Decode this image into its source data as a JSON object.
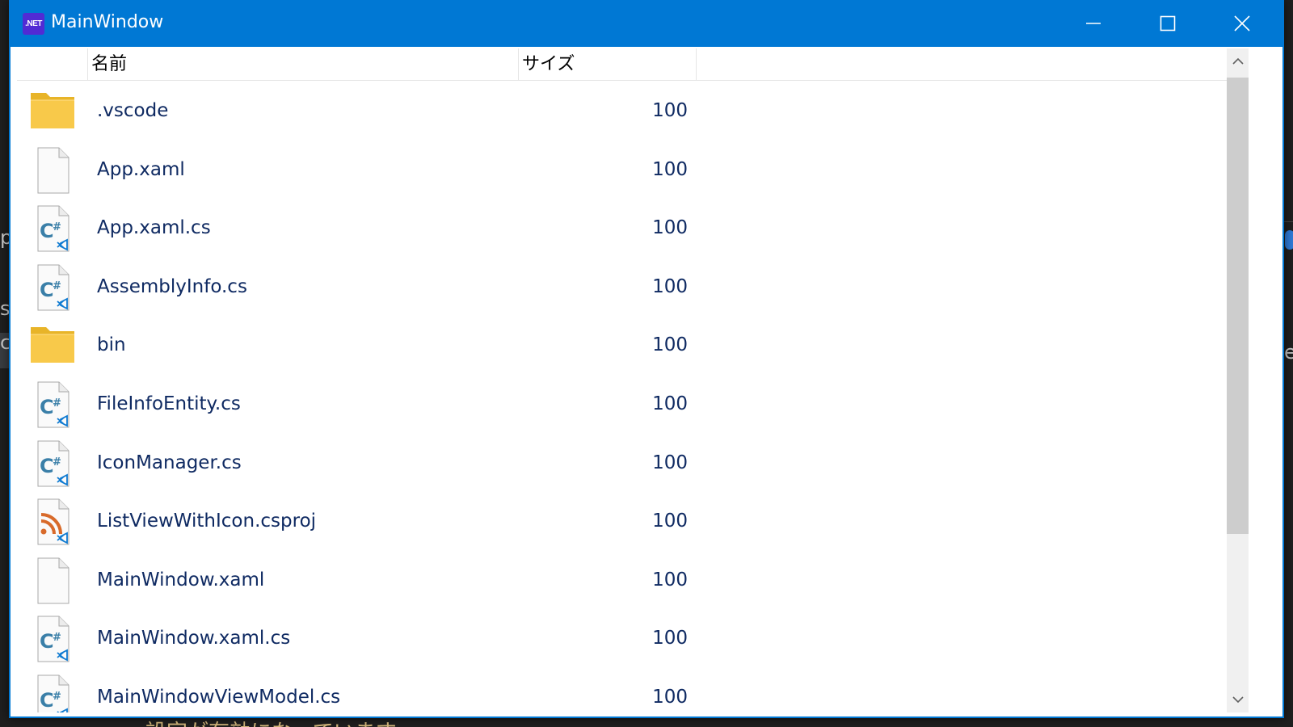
{
  "window": {
    "title": "MainWindow",
    "app_icon_text": ".NET"
  },
  "columns": {
    "name": "名前",
    "size": "サイズ"
  },
  "files": [
    {
      "name": ".vscode",
      "size": "100",
      "icon": "folder-icon"
    },
    {
      "name": "App.xaml",
      "size": "100",
      "icon": "file-icon"
    },
    {
      "name": "App.xaml.cs",
      "size": "100",
      "icon": "csharp-file-icon"
    },
    {
      "name": "AssemblyInfo.cs",
      "size": "100",
      "icon": "csharp-file-icon"
    },
    {
      "name": "bin",
      "size": "100",
      "icon": "folder-icon"
    },
    {
      "name": "FileInfoEntity.cs",
      "size": "100",
      "icon": "csharp-file-icon"
    },
    {
      "name": "IconManager.cs",
      "size": "100",
      "icon": "csharp-file-icon"
    },
    {
      "name": "ListViewWithIcon.csproj",
      "size": "100",
      "icon": "csproj-file-icon"
    },
    {
      "name": "MainWindow.xaml",
      "size": "100",
      "icon": "file-icon"
    },
    {
      "name": "MainWindow.xaml.cs",
      "size": "100",
      "icon": "csharp-file-icon"
    },
    {
      "name": "MainWindowViewModel.cs",
      "size": "100",
      "icon": "csharp-file-icon"
    }
  ],
  "background": {
    "bottom_text": "設定が有効になっています",
    "left_glyphs": [
      "p",
      "s",
      "c"
    ],
    "right_glyph": "e"
  },
  "colors": {
    "titlebar": "#0078d4",
    "item_text": "#0f2a62",
    "folder": "#f8c94a",
    "csharp": "#3a7fa8",
    "csproj": "#d86a2a",
    "vscode_badge": "#0e7ad1"
  }
}
